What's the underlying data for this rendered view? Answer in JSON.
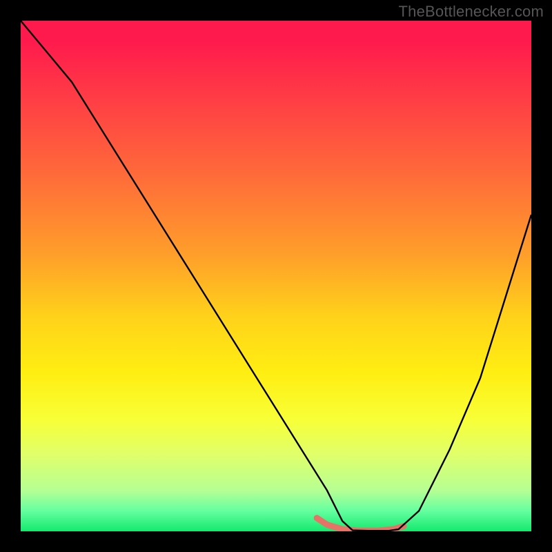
{
  "watermark": "TheBottlenecker.com",
  "chart_data": {
    "type": "line",
    "title": "",
    "xlabel": "",
    "ylabel": "",
    "xlim": [
      0,
      100
    ],
    "ylim": [
      0,
      100
    ],
    "grid": false,
    "legend": false,
    "description": "Bottleneck curve over a vertical red→green gradient background. A black line descends from top-left to a flat minimum near x≈63–73 (at the green band), then rises toward the right edge. A short coral/red flat segment marks the sweet-spot at the bottom.",
    "series": [
      {
        "name": "black-curve",
        "color": "#000000",
        "x": [
          0,
          5,
          10,
          15,
          20,
          25,
          30,
          35,
          40,
          45,
          50,
          55,
          60,
          63,
          65,
          68,
          72,
          74,
          78,
          84,
          90,
          95,
          100
        ],
        "values": [
          100,
          94,
          88,
          80,
          72,
          64,
          56,
          48,
          40,
          32,
          24,
          16,
          8,
          2,
          0.2,
          0.1,
          0.1,
          0.4,
          4,
          16,
          30,
          46,
          62
        ]
      },
      {
        "name": "sweet-spot",
        "color": "#e57367",
        "x": [
          58,
          60,
          63,
          66,
          70,
          73,
          75
        ],
        "values": [
          2.6,
          1.3,
          0.4,
          0.1,
          0.1,
          0.4,
          1.0
        ]
      }
    ],
    "gradient_stops": [
      {
        "pos": 0.0,
        "color": "#ff1a4d"
      },
      {
        "pos": 0.04,
        "color": "#ff1a4d"
      },
      {
        "pos": 0.14,
        "color": "#ff3946"
      },
      {
        "pos": 0.3,
        "color": "#ff6a3a"
      },
      {
        "pos": 0.46,
        "color": "#ff9f2a"
      },
      {
        "pos": 0.58,
        "color": "#ffd21a"
      },
      {
        "pos": 0.69,
        "color": "#ffee12"
      },
      {
        "pos": 0.78,
        "color": "#f8ff36"
      },
      {
        "pos": 0.85,
        "color": "#e0ff6a"
      },
      {
        "pos": 0.92,
        "color": "#b6ff93"
      },
      {
        "pos": 0.96,
        "color": "#64ffa0"
      },
      {
        "pos": 1.0,
        "color": "#14e96e"
      }
    ]
  }
}
